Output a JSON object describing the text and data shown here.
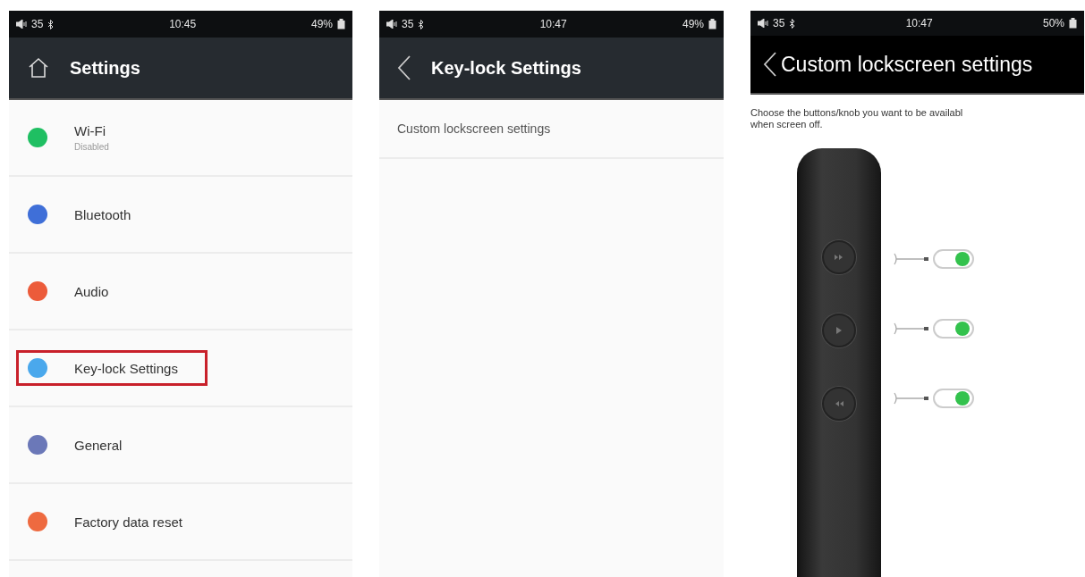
{
  "screens": [
    {
      "kind": "menu",
      "status_bar": {
        "volume": "35",
        "time": "10:45",
        "battery": "49%"
      },
      "header": {
        "kind": "home",
        "title": "Settings"
      },
      "items": [
        {
          "label": "Wi-Fi",
          "subtitle": "Disabled",
          "color": "#1fbf62",
          "selected": false
        },
        {
          "label": "Bluetooth",
          "color": "#3f6fd8",
          "selected": false
        },
        {
          "label": "Audio",
          "color": "#ec5b3a",
          "selected": false
        },
        {
          "label": "Key-lock Settings",
          "color": "#4aa8ec",
          "selected": true
        },
        {
          "label": "General",
          "color": "#6b78b8",
          "selected": false
        },
        {
          "label": "Factory data reset",
          "color": "#ee6a40",
          "selected": false
        }
      ]
    },
    {
      "kind": "menu",
      "status_bar": {
        "volume": "35",
        "time": "10:47",
        "battery": "49%"
      },
      "header": {
        "kind": "back",
        "title": "Key-lock Settings"
      },
      "items": [
        {
          "label": "Custom lockscreen settings",
          "selected": false
        }
      ]
    },
    {
      "kind": "device",
      "status_bar": {
        "volume": "35",
        "time": "10:47",
        "battery": "50%"
      },
      "header": {
        "kind": "back",
        "title": "Custom lockscreen settings"
      },
      "description_lines": [
        "Choose the buttons/knob you want to be availabl",
        "when screen off."
      ],
      "toggles": [
        {
          "kind": "next",
          "on": true
        },
        {
          "kind": "play",
          "on": true
        },
        {
          "kind": "prev",
          "on": true
        }
      ]
    }
  ]
}
